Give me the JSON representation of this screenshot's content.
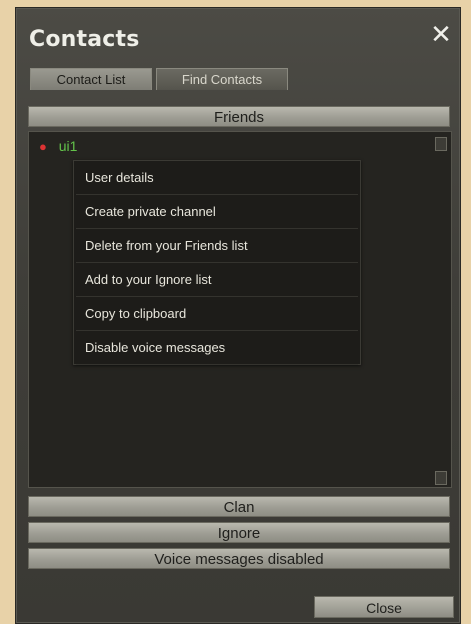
{
  "window": {
    "title": "Contacts",
    "close_icon": "close-icon"
  },
  "tabs": [
    {
      "label": "Contact List",
      "active": true
    },
    {
      "label": "Find Contacts",
      "active": false
    }
  ],
  "groups": {
    "friends": "Friends",
    "clan": "Clan",
    "ignore": "Ignore",
    "voice": "Voice messages disabled"
  },
  "contacts": [
    {
      "name": "ui1",
      "status_color": "#dd3333"
    }
  ],
  "context_menu": [
    {
      "label": "User details"
    },
    {
      "label": "Create private channel"
    },
    {
      "label": "Delete from your Friends list"
    },
    {
      "label": "Add to your Ignore list"
    },
    {
      "label": "Copy to clipboard"
    },
    {
      "label": "Disable voice messages"
    }
  ],
  "footer": {
    "close_label": "Close"
  }
}
